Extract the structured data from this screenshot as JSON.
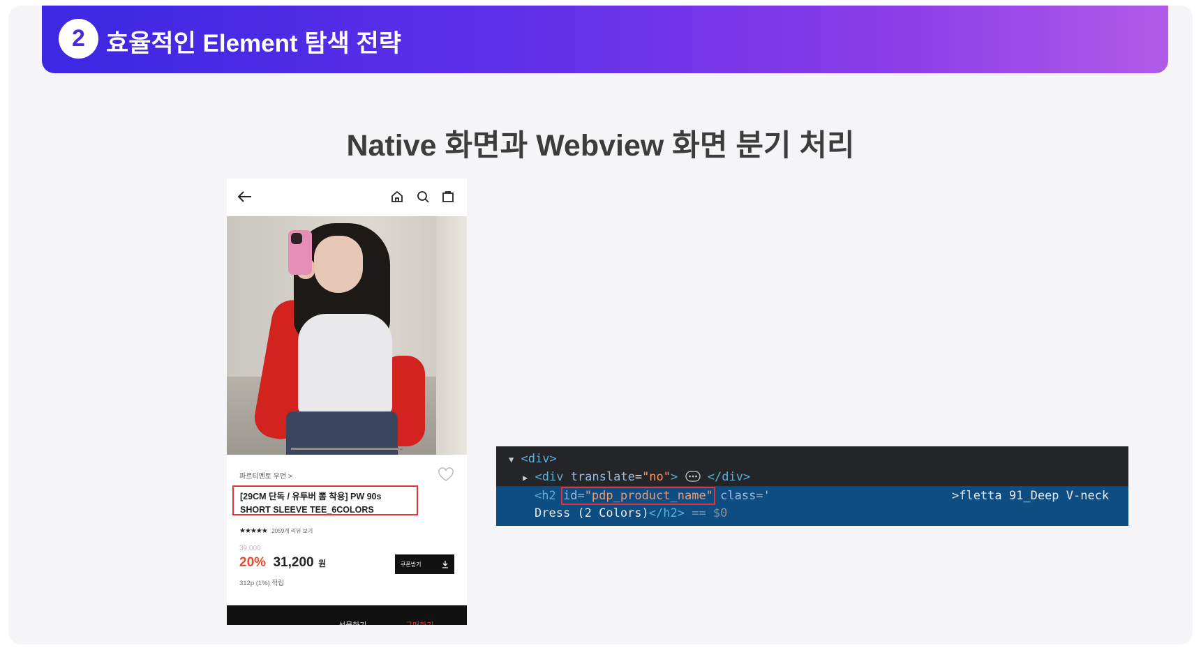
{
  "header": {
    "step_number": "2",
    "title": "효율적인 Element 탐색 전략"
  },
  "subtitle": "Native 화면과 Webview 화면 분기 처리",
  "phone": {
    "top_icons": [
      "back-arrow-icon",
      "home-icon",
      "search-icon",
      "shopping-bag-icon"
    ],
    "brand_link": "파르티멘토 우먼 >",
    "product_title_line1": "[29CM 단독 / 유투버 뽐 착용] PW 90s",
    "product_title_line2": "SHORT SLEEVE TEE_6COLORS",
    "rating_stars": "★★★★★",
    "review_count": "2059개 리뷰 보기",
    "original_price": "39,000",
    "discount": "20%",
    "price": "31,200",
    "currency": "원",
    "points": "312p (1%) 적립",
    "coupon_label": "쿠폰받기",
    "bottom_actions": [
      "선물하기",
      "구매하기"
    ]
  },
  "devtools": {
    "line1_tag": "<div>",
    "line2_open": "<div",
    "line2_attr": "translate",
    "line2_value": "\"no\"",
    "line2_close": "</div>",
    "line3_tag_open": "<h2",
    "line3_attr_id": "id=",
    "line3_value_id": "\"pdp_product_name\"",
    "line3_attr_class": "class='",
    "line3_text": ">fletta 91_Deep V-neck",
    "line4_text": "Dress (2 Colors)",
    "line4_close": "</h2>",
    "line4_ref": "== $0"
  },
  "colors": {
    "header_start": "#3b27e2",
    "header_end": "#b25be8",
    "highlight": "#e3333a",
    "discount": "#ea4b2c"
  }
}
